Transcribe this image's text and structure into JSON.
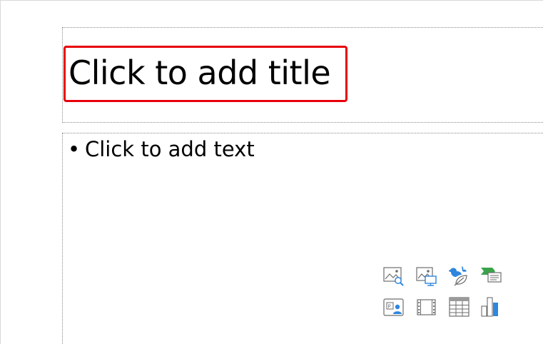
{
  "slide": {
    "title_placeholder": "Click to add title",
    "body_bullet": "•",
    "body_placeholder": "Click to add text"
  },
  "content_icons": [
    {
      "name": "stock-images-icon"
    },
    {
      "name": "online-pictures-icon"
    },
    {
      "name": "icons-icon"
    },
    {
      "name": "smartart-icon"
    },
    {
      "name": "cameo-icon"
    },
    {
      "name": "insert-video-icon"
    },
    {
      "name": "insert-table-icon"
    },
    {
      "name": "insert-chart-icon"
    }
  ],
  "colors": {
    "highlight": "#e8000b",
    "placeholder_border": "#8a8a8a",
    "icon_blue": "#2e86de",
    "icon_gray": "#6d6d6d",
    "icon_green": "#3aa34a"
  }
}
